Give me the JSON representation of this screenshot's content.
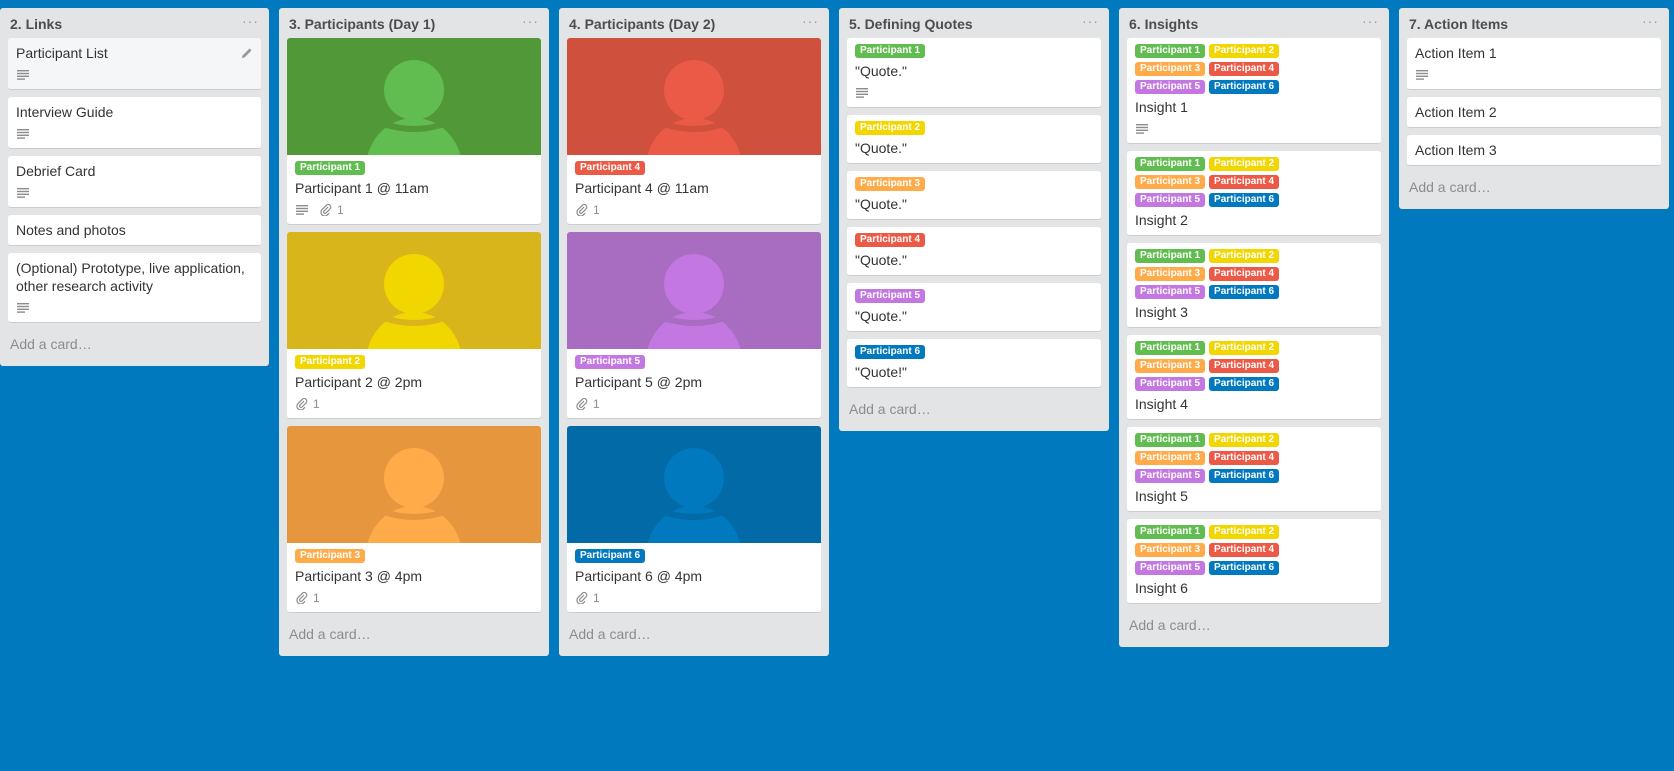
{
  "colors": {
    "green": "#61bd4f",
    "yellow": "#f2d600",
    "orange": "#ffab4a",
    "red": "#eb5a46",
    "purple": "#c377e0",
    "blue": "#0079bf",
    "board_bg": "#0079bf"
  },
  "add_card_label": "Add a card…",
  "lists": [
    {
      "title": "2. Links",
      "menu": "···",
      "cards": [
        {
          "title": "Participant List",
          "description_icon": "description-icon",
          "edit_icon": "pencil-icon"
        },
        {
          "title": "Interview Guide",
          "description_icon": "description-icon"
        },
        {
          "title": "Debrief Card",
          "description_icon": "description-icon"
        },
        {
          "title": "Notes and photos"
        },
        {
          "title": "(Optional) Prototype, live application, other research activity",
          "description_icon": "description-icon"
        }
      ]
    },
    {
      "title": "3. Participants (Day 1)",
      "menu": "···",
      "cards": [
        {
          "label": "Participant 1",
          "title": "Participant 1 @ 11am",
          "attachments": "1"
        },
        {
          "label": "Participant 2",
          "title": "Participant 2 @ 2pm",
          "attachments": "1"
        },
        {
          "label": "Participant 3",
          "title": "Participant 3 @ 4pm",
          "attachments": "1"
        }
      ]
    },
    {
      "title": "4. Participants (Day 2)",
      "menu": "···",
      "cards": [
        {
          "label": "Participant 4",
          "title": "Participant 4 @ 11am",
          "attachments": "1"
        },
        {
          "label": "Participant 5",
          "title": "Participant 5 @ 2pm",
          "attachments": "1"
        },
        {
          "label": "Participant 6",
          "title": "Participant 6 @ 4pm",
          "attachments": "1"
        }
      ]
    },
    {
      "title": "5. Defining Quotes",
      "menu": "···",
      "cards": [
        {
          "label": "Participant 1",
          "title": "\"Quote.\""
        },
        {
          "label": "Participant 2",
          "title": "\"Quote.\""
        },
        {
          "label": "Participant 3",
          "title": "\"Quote.\""
        },
        {
          "label": "Participant 4",
          "title": "\"Quote.\""
        },
        {
          "label": "Participant 5",
          "title": "\"Quote.\""
        },
        {
          "label": "Participant 6",
          "title": "\"Quote!\""
        }
      ]
    },
    {
      "title": "6. Insights",
      "menu": "···",
      "labels": [
        "Participant 1",
        "Participant 2",
        "Participant 3",
        "Participant 4",
        "Participant 5",
        "Participant 6"
      ],
      "cards": [
        {
          "title": "Insight 1"
        },
        {
          "title": "Insight 2"
        },
        {
          "title": "Insight 3"
        },
        {
          "title": "Insight 4"
        },
        {
          "title": "Insight 5"
        },
        {
          "title": "Insight 6"
        }
      ]
    },
    {
      "title": "7. Action Items",
      "menu": "···",
      "cards": [
        {
          "title": "Action Item 1"
        },
        {
          "title": "Action Item 2"
        },
        {
          "title": "Action Item 3"
        }
      ]
    }
  ]
}
